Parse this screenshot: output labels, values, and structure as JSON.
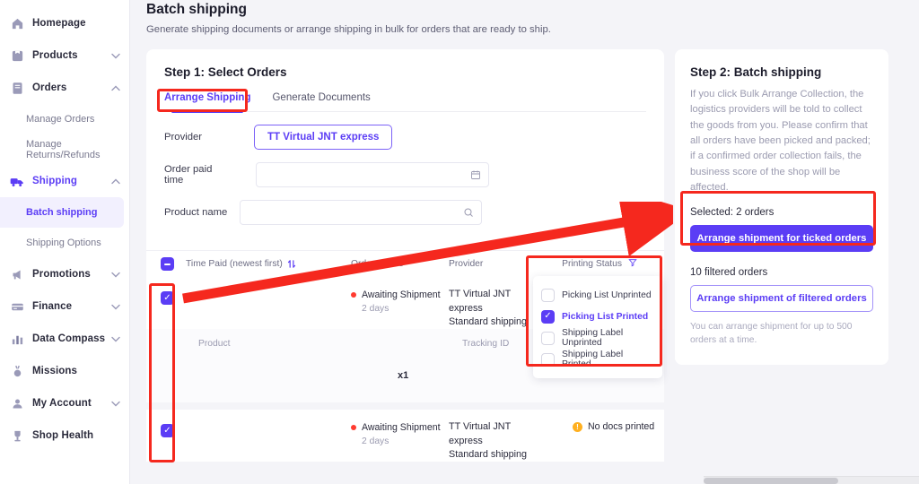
{
  "sidebar": {
    "items": [
      {
        "label": "Homepage",
        "icon": "home-icon",
        "type": "nav",
        "chevron": "",
        "active": false
      },
      {
        "label": "Products",
        "icon": "products-icon",
        "type": "nav",
        "chevron": "v",
        "active": false
      },
      {
        "label": "Orders",
        "icon": "orders-icon",
        "type": "nav",
        "chevron": "^",
        "active": false
      },
      {
        "label": "Manage Orders",
        "icon": "",
        "type": "sub",
        "chevron": "",
        "active": false
      },
      {
        "label": "Manage Returns/Refunds",
        "icon": "",
        "type": "sub",
        "chevron": "",
        "active": false
      },
      {
        "label": "Shipping",
        "icon": "truck-icon",
        "type": "nav",
        "chevron": "^",
        "active": true
      },
      {
        "label": "Batch shipping",
        "icon": "",
        "type": "sub",
        "chevron": "",
        "active": true
      },
      {
        "label": "Shipping Options",
        "icon": "",
        "type": "sub",
        "chevron": "",
        "active": false
      },
      {
        "label": "Promotions",
        "icon": "megaphone-icon",
        "type": "nav",
        "chevron": "v",
        "active": false
      },
      {
        "label": "Finance",
        "icon": "card-icon",
        "type": "nav",
        "chevron": "v",
        "active": false
      },
      {
        "label": "Data Compass",
        "icon": "bar-chart-icon",
        "type": "nav",
        "chevron": "v",
        "active": false
      },
      {
        "label": "Missions",
        "icon": "medal-icon",
        "type": "nav",
        "chevron": "",
        "active": false
      },
      {
        "label": "My Account",
        "icon": "person-icon",
        "type": "nav",
        "chevron": "v",
        "active": false
      },
      {
        "label": "Shop Health",
        "icon": "trophy-icon",
        "type": "nav",
        "chevron": "",
        "active": false
      }
    ]
  },
  "header": {
    "title": "Batch shipping",
    "subtitle": "Generate shipping documents or arrange shipping in bulk for orders that are ready to ship."
  },
  "step1": {
    "title": "Step 1: Select Orders",
    "tabs": [
      {
        "label": "Arrange Shipping",
        "active": true
      },
      {
        "label": "Generate Documents",
        "active": false
      }
    ],
    "form": {
      "provider_label": "Provider",
      "provider_chip": "TT Virtual JNT express",
      "paid_time_label": "Order paid time",
      "paid_time_value": "",
      "paid_time_placeholder": "",
      "paid_time_icon": "calendar-icon",
      "product_name_label": "Product name",
      "product_name_value": "",
      "product_name_placeholder": "",
      "product_name_icon": "search-icon"
    },
    "table": {
      "headers": {
        "time_paid": "Time Paid (newest first)",
        "sort_icon": "sort-icon",
        "order_status": "Order Status",
        "provider": "Provider",
        "printing_status": "Printing Status",
        "filter_icon": "filter-icon"
      },
      "sub_headers": {
        "product": "Product",
        "tracking_id": "Tracking ID"
      },
      "rows": [
        {
          "checked": true,
          "status": "Awaiting Shipment",
          "age": "2 days",
          "provider_line1": "TT Virtual JNT",
          "provider_line2": "express",
          "provider_line3": "Standard shipping",
          "printing_status": "",
          "qty": "x1"
        },
        {
          "checked": true,
          "status": "Awaiting Shipment",
          "age": "2 days",
          "provider_line1": "TT Virtual JNT",
          "provider_line2": "express",
          "provider_line3": "Standard shipping",
          "printing_status": "No docs printed",
          "qty": ""
        }
      ]
    },
    "printing_filter": {
      "options": [
        {
          "label": "Picking List Unprinted",
          "checked": false
        },
        {
          "label": "Picking List Printed",
          "checked": true
        },
        {
          "label": "Shipping Label Unprinted",
          "checked": false
        },
        {
          "label": "Shipping Label Printed",
          "checked": false
        }
      ]
    }
  },
  "step2": {
    "title": "Step 2: Batch shipping",
    "description": "If you click Bulk Arrange Collection, the logistics providers will be told to collect the goods from you. Please confirm that all orders have been picked and packed; if a confirmed order collection fails, the business score of the shop will be affected.",
    "selected_text": "Selected: 2 orders",
    "primary_button": "Arrange shipment for ticked orders",
    "filtered_text": "10 filtered orders",
    "outline_button": "Arrange shipment of filtered orders",
    "hint": "You can arrange shipment for up to 500 orders at a time."
  },
  "colors": {
    "brand": "#5b3df5",
    "annotation": "#f5281e",
    "status_red": "#ff3b30",
    "warn_amber": "#ffb020",
    "page_bg": "#f4f4f8"
  }
}
